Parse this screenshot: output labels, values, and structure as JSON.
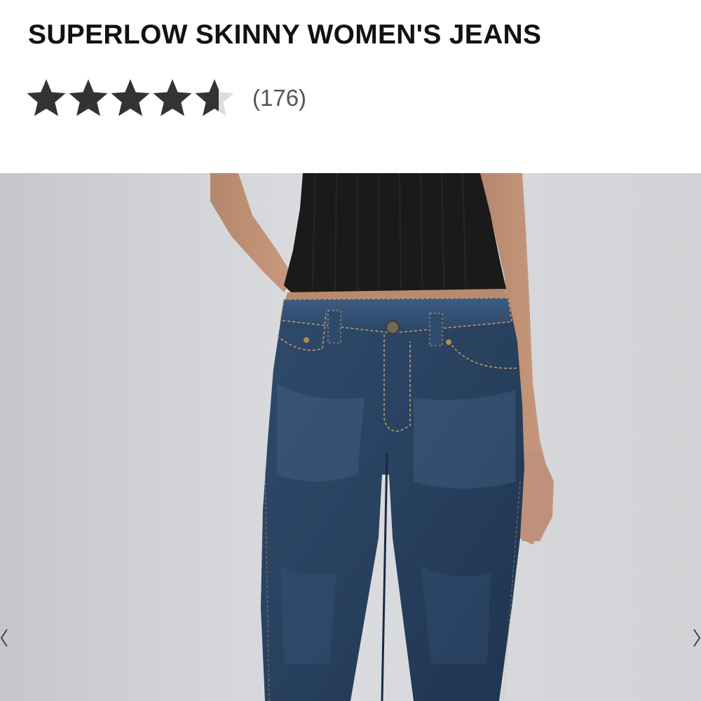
{
  "product": {
    "title": "SUPERLOW SKINNY WOMEN'S JEANS",
    "rating": 4.6,
    "rating_max": 5,
    "review_count": "(176)"
  },
  "colors": {
    "star_filled": "#333333",
    "star_empty": "#dddddd",
    "title": "#111111",
    "count": "#555555"
  },
  "gallery": {
    "image": "product-photo-woman-wearing-dark-wash-low-rise-skinny-jeans-and-black-ribbed-tank-top",
    "prev_icon": "chevron-left-icon",
    "next_icon": "chevron-right-icon"
  }
}
